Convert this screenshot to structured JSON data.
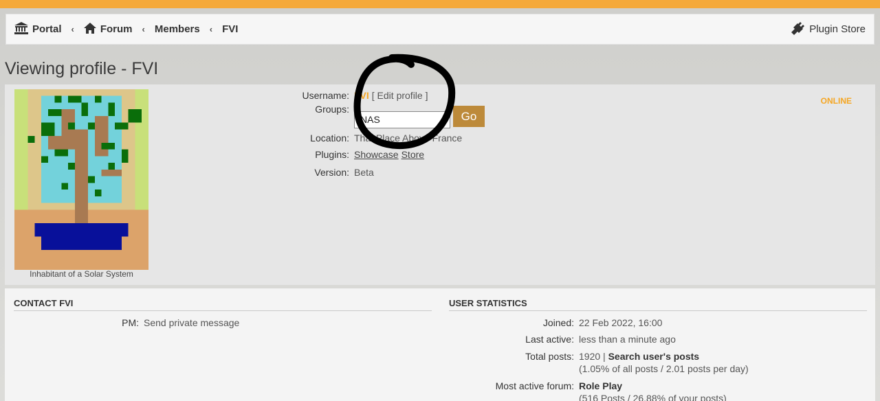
{
  "colors": {
    "accent": "#f5a93a",
    "username": "#f5a623",
    "go_button": "#bd8a3a",
    "marker": "#000000"
  },
  "navbar": {
    "breadcrumbs": [
      {
        "label": "Portal",
        "icon": "bank-icon"
      },
      {
        "label": "Forum",
        "icon": "home-icon"
      },
      {
        "label": "Members"
      },
      {
        "label": "FVI"
      }
    ],
    "separator": "‹",
    "plugin_store": {
      "label": "Plugin Store",
      "icon": "plug-icon"
    }
  },
  "page_title": "Viewing profile - FVI",
  "profile": {
    "avatar_caption": "Inhabitant of a Solar System",
    "username_label": "Username:",
    "username": "FVI",
    "edit_profile": "[ Edit profile ]",
    "groups_label": "Groups:",
    "groups_selected": "NAS",
    "go_label": "Go",
    "location_label": "Location:",
    "location": "That Place Above France",
    "plugins_label": "Plugins:",
    "plugin_showcase": "Showcase",
    "plugin_store": "Store",
    "version_label": "Version:",
    "version": "Beta",
    "status": "ONLINE"
  },
  "contact": {
    "heading": "CONTACT FVI",
    "pm_label": "PM:",
    "pm_value": "Send private message"
  },
  "stats": {
    "heading": "USER STATISTICS",
    "joined_label": "Joined:",
    "joined": "22 Feb 2022, 16:00",
    "last_active_label": "Last active:",
    "last_active": "less than a minute ago",
    "total_posts_label": "Total posts:",
    "total_posts": "1920",
    "total_posts_sep": " | ",
    "search_posts": "Search user's posts",
    "posts_detail": "(1.05% of all posts / 2.01 posts per day)",
    "most_active_label": "Most active forum:",
    "most_active": "Role Play",
    "most_active_detail": "(516 Posts / 26.88% of your posts)"
  }
}
